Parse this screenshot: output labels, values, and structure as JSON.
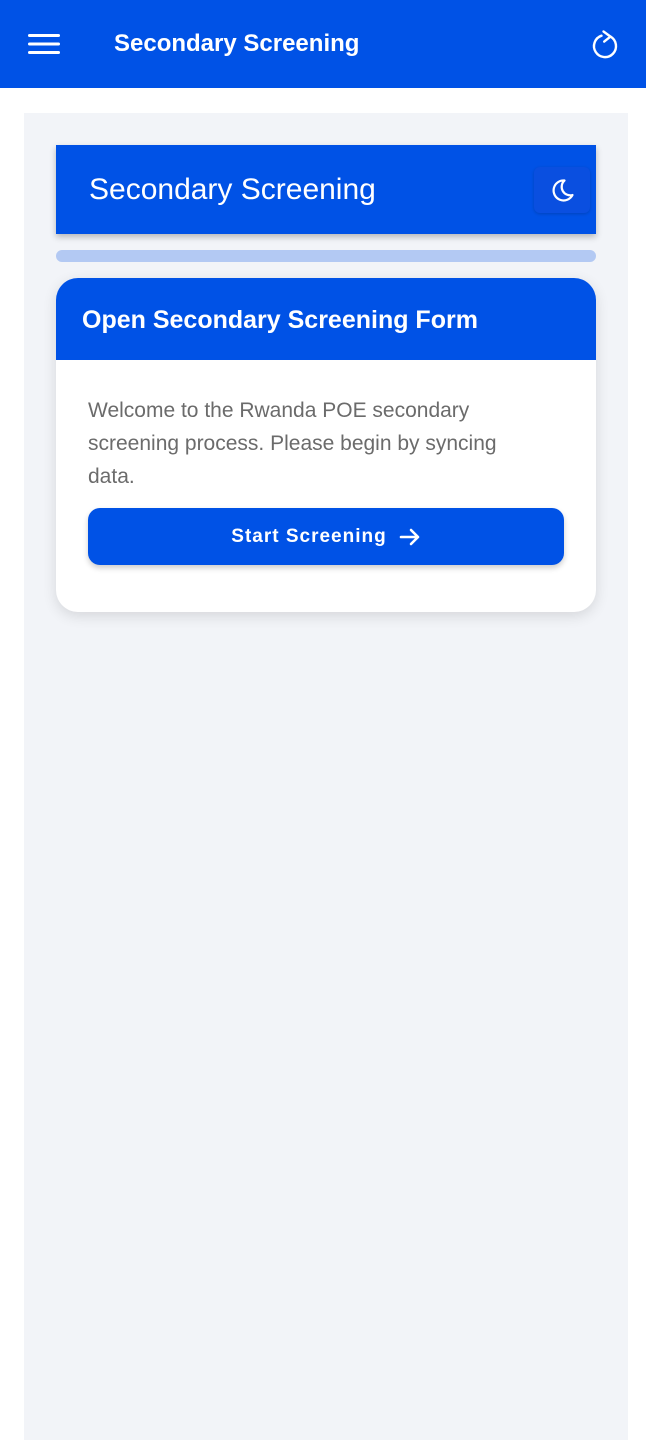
{
  "app_bar": {
    "title": "Secondary Screening",
    "menu_icon": "menu-icon",
    "refresh_icon": "refresh-icon",
    "color": "#0052e6"
  },
  "section": {
    "title": "Secondary Screening",
    "theme_icon": "moon-icon"
  },
  "card": {
    "title": "Open Secondary Screening Form",
    "description": "Welcome to the Rwanda POE secondary screening process. Please begin by syncing data.",
    "button_label": "Start Screening",
    "button_icon": "arrow-right-icon"
  },
  "colors": {
    "primary": "#0052e6",
    "background": "#f2f4f8",
    "progress_track": "#b3c9f3",
    "body_text": "#6b6b6b"
  }
}
